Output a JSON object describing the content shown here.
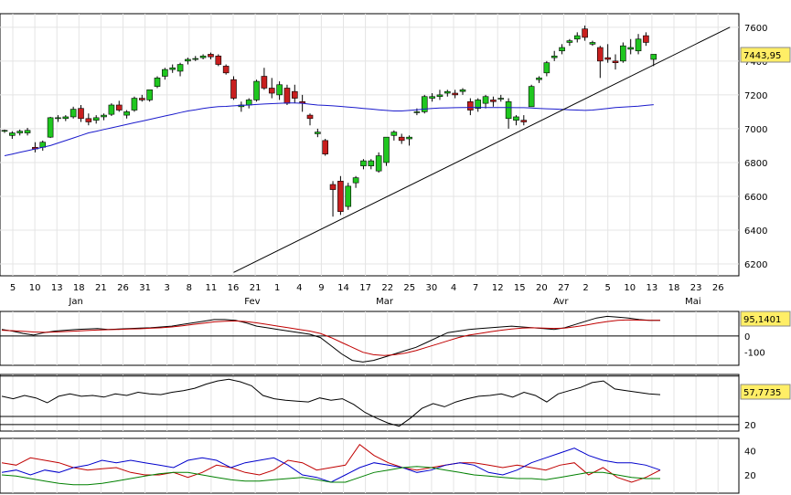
{
  "chart_data": [
    {
      "type": "candlestick",
      "title": "",
      "last_value": "7443,95",
      "ylim": [
        6130,
        7680
      ],
      "y_ticks": [
        {
          "value": 6200,
          "label": "6200"
        },
        {
          "value": 6400,
          "label": "6400"
        },
        {
          "value": 6600,
          "label": "6600"
        },
        {
          "value": 6800,
          "label": "6800"
        },
        {
          "value": 7000,
          "label": "7000"
        },
        {
          "value": 7200,
          "label": "7200"
        },
        {
          "value": 7400,
          "label": "7400"
        },
        {
          "value": 7600,
          "label": "7600"
        }
      ],
      "x_day_labels": [
        "5",
        "10",
        "13",
        "18",
        "21",
        "26",
        "31",
        "3",
        "8",
        "11",
        "16",
        "21",
        "1",
        "4",
        "9",
        "14",
        "17",
        "22",
        "25",
        "30",
        "4",
        "7",
        "12",
        "15",
        "20",
        "27",
        "2",
        "5",
        "10",
        "13",
        "18",
        "23",
        "26"
      ],
      "x_month_labels": [
        {
          "label": "Jan",
          "after_day_index": 1
        },
        {
          "label": "Fev",
          "after_day_index": 9
        },
        {
          "label": "Mar",
          "after_day_index": 15
        },
        {
          "label": "Avr",
          "after_day_index": 23
        },
        {
          "label": "Mai",
          "after_day_index": 29
        }
      ],
      "candles": [
        [
          6985,
          6995,
          6975,
          6990
        ],
        [
          6960,
          6985,
          6940,
          6975
        ],
        [
          6975,
          6995,
          6960,
          6985
        ],
        [
          6975,
          7005,
          6960,
          6990
        ],
        [
          6890,
          6920,
          6860,
          6880
        ],
        [
          6890,
          6930,
          6870,
          6920
        ],
        [
          6950,
          7070,
          6945,
          7065
        ],
        [
          7060,
          7080,
          7040,
          7065
        ],
        [
          7060,
          7080,
          7045,
          7070
        ],
        [
          7070,
          7130,
          7060,
          7115
        ],
        [
          7120,
          7140,
          7040,
          7060
        ],
        [
          7060,
          7090,
          7020,
          7040
        ],
        [
          7050,
          7080,
          7030,
          7065
        ],
        [
          7070,
          7090,
          7050,
          7080
        ],
        [
          7085,
          7150,
          7075,
          7140
        ],
        [
          7140,
          7165,
          7100,
          7110
        ],
        [
          7080,
          7110,
          7060,
          7100
        ],
        [
          7110,
          7190,
          7100,
          7180
        ],
        [
          7180,
          7200,
          7160,
          7170
        ],
        [
          7170,
          7230,
          7160,
          7230
        ],
        [
          7250,
          7310,
          7240,
          7300
        ],
        [
          7310,
          7360,
          7290,
          7350
        ],
        [
          7350,
          7380,
          7330,
          7360
        ],
        [
          7340,
          7390,
          7310,
          7380
        ],
        [
          7400,
          7420,
          7380,
          7410
        ],
        [
          7410,
          7430,
          7400,
          7415
        ],
        [
          7420,
          7440,
          7410,
          7430
        ],
        [
          7440,
          7450,
          7410,
          7425
        ],
        [
          7430,
          7440,
          7370,
          7380
        ],
        [
          7370,
          7380,
          7320,
          7330
        ],
        [
          7290,
          7310,
          7170,
          7180
        ],
        [
          7130,
          7160,
          7100,
          7140
        ],
        [
          7140,
          7180,
          7120,
          7170
        ],
        [
          7170,
          7290,
          7160,
          7280
        ],
        [
          7310,
          7360,
          7230,
          7240
        ],
        [
          7240,
          7300,
          7180,
          7210
        ],
        [
          7200,
          7280,
          7170,
          7260
        ],
        [
          7240,
          7260,
          7140,
          7150
        ],
        [
          7220,
          7260,
          7150,
          7180
        ],
        [
          7160,
          7200,
          7100,
          7150
        ],
        [
          7080,
          7090,
          7020,
          7060
        ],
        [
          6970,
          7000,
          6950,
          6980
        ],
        [
          6930,
          6940,
          6840,
          6850
        ],
        [
          6670,
          6690,
          6480,
          6640
        ],
        [
          6690,
          6720,
          6490,
          6510
        ],
        [
          6540,
          6680,
          6520,
          6660
        ],
        [
          6680,
          6720,
          6650,
          6710
        ],
        [
          6780,
          6820,
          6760,
          6810
        ],
        [
          6780,
          6820,
          6760,
          6810
        ],
        [
          6750,
          6860,
          6740,
          6840
        ],
        [
          6800,
          6950,
          6780,
          6950
        ],
        [
          6960,
          6990,
          6930,
          6980
        ],
        [
          6950,
          6970,
          6910,
          6930
        ],
        [
          6940,
          6960,
          6900,
          6950
        ],
        [
          7100,
          7120,
          7080,
          7100
        ],
        [
          7100,
          7200,
          7090,
          7190
        ],
        [
          7180,
          7210,
          7160,
          7190
        ],
        [
          7190,
          7230,
          7170,
          7200
        ],
        [
          7210,
          7230,
          7190,
          7220
        ],
        [
          7210,
          7230,
          7180,
          7200
        ],
        [
          7220,
          7240,
          7200,
          7230
        ],
        [
          7160,
          7180,
          7080,
          7110
        ],
        [
          7120,
          7180,
          7100,
          7170
        ],
        [
          7150,
          7200,
          7120,
          7190
        ],
        [
          7170,
          7190,
          7130,
          7160
        ],
        [
          7180,
          7200,
          7160,
          7180
        ],
        [
          7060,
          7180,
          7000,
          7160
        ],
        [
          7050,
          7080,
          7020,
          7070
        ],
        [
          7050,
          7080,
          7020,
          7040
        ],
        [
          7130,
          7260,
          7130,
          7250
        ],
        [
          7290,
          7310,
          7270,
          7300
        ],
        [
          7330,
          7400,
          7310,
          7390
        ],
        [
          7420,
          7460,
          7400,
          7430
        ],
        [
          7460,
          7500,
          7440,
          7480
        ],
        [
          7510,
          7530,
          7490,
          7520
        ],
        [
          7530,
          7570,
          7510,
          7550
        ],
        [
          7590,
          7610,
          7520,
          7540
        ],
        [
          7500,
          7520,
          7490,
          7510
        ],
        [
          7480,
          7490,
          7300,
          7400
        ],
        [
          7420,
          7500,
          7390,
          7410
        ],
        [
          7400,
          7440,
          7350,
          7390
        ],
        [
          7400,
          7510,
          7390,
          7490
        ],
        [
          7470,
          7530,
          7440,
          7480
        ],
        [
          7460,
          7560,
          7440,
          7530
        ],
        [
          7550,
          7570,
          7490,
          7510
        ],
        [
          7410,
          7440,
          7370,
          7440
        ]
      ],
      "moving_average": [
        6840,
        6850,
        6860,
        6870,
        6880,
        6890,
        6900,
        6915,
        6930,
        6945,
        6960,
        6975,
        6985,
        6995,
        7005,
        7015,
        7025,
        7035,
        7045,
        7055,
        7065,
        7075,
        7085,
        7095,
        7105,
        7112,
        7120,
        7126,
        7130,
        7132,
        7135,
        7138,
        7140,
        7143,
        7146,
        7148,
        7150,
        7152,
        7152,
        7150,
        7145,
        7140,
        7138,
        7135,
        7132,
        7128,
        7124,
        7120,
        7116,
        7112,
        7108,
        7105,
        7105,
        7108,
        7112,
        7116,
        7120,
        7122,
        7123,
        7124,
        7125,
        7126,
        7126,
        7125,
        7125,
        7125,
        7125,
        7124,
        7124,
        7122,
        7120,
        7118,
        7116,
        7114,
        7112,
        7110,
        7108,
        7110,
        7115,
        7120,
        7125,
        7128,
        7130,
        7133,
        7138,
        7142
      ],
      "trendline": {
        "start": {
          "index": 30,
          "value": 6150
        },
        "end": {
          "index": 95,
          "value": 7600
        }
      }
    },
    {
      "type": "line",
      "last_value": "95,1401",
      "ylim": [
        -180,
        150
      ],
      "y_ticks": [
        {
          "value": 0,
          "label": "0"
        },
        {
          "value": -100,
          "label": "-100"
        }
      ],
      "ref_lines": [
        0
      ],
      "series": [
        {
          "color": "#000000",
          "values": [
            40,
            30,
            15,
            5,
            20,
            30,
            35,
            40,
            42,
            45,
            40,
            42,
            45,
            48,
            50,
            55,
            60,
            70,
            80,
            90,
            100,
            100,
            95,
            80,
            60,
            50,
            40,
            30,
            20,
            10,
            -10,
            -60,
            -110,
            -150,
            -160,
            -150,
            -130,
            -110,
            -90,
            -70,
            -40,
            -10,
            20,
            30,
            40,
            45,
            50,
            55,
            60,
            55,
            50,
            45,
            40,
            50,
            70,
            90,
            110,
            120,
            115,
            110,
            100,
            95,
            95
          ]
        },
        {
          "color": "#c00000",
          "values": [
            35,
            32,
            28,
            24,
            22,
            24,
            27,
            30,
            33,
            36,
            38,
            40,
            42,
            44,
            47,
            50,
            55,
            62,
            70,
            78,
            86,
            90,
            92,
            88,
            80,
            70,
            60,
            50,
            40,
            30,
            15,
            -10,
            -40,
            -70,
            -100,
            -115,
            -120,
            -115,
            -105,
            -90,
            -70,
            -50,
            -30,
            -10,
            5,
            15,
            25,
            35,
            42,
            48,
            50,
            48,
            46,
            48,
            56,
            66,
            78,
            88,
            95,
            98,
            97,
            96,
            95
          ]
        }
      ]
    },
    {
      "type": "line",
      "last_value": "57,7735",
      "ylim": [
        12,
        82
      ],
      "y_ticks": [
        {
          "value": 20,
          "label": "20"
        }
      ],
      "ref_lines": [
        80,
        30,
        20
      ],
      "series": [
        {
          "color": "#000000",
          "values": [
            55,
            52,
            56,
            53,
            47,
            55,
            58,
            55,
            56,
            54,
            58,
            56,
            60,
            58,
            57,
            60,
            62,
            65,
            70,
            74,
            76,
            73,
            68,
            56,
            52,
            50,
            49,
            48,
            53,
            50,
            52,
            45,
            35,
            28,
            22,
            18,
            28,
            40,
            46,
            42,
            48,
            52,
            55,
            56,
            58,
            54,
            60,
            56,
            48,
            58,
            62,
            66,
            72,
            74,
            64,
            62,
            60,
            58,
            57
          ]
        },
        {
          "color": "#000000",
          "values": []
        }
      ]
    },
    {
      "type": "line",
      "ylim": [
        5,
        50
      ],
      "y_ticks": [
        {
          "value": 40,
          "label": "40"
        },
        {
          "value": 20,
          "label": "20"
        }
      ],
      "series": [
        {
          "color": "#c00000",
          "values": [
            30,
            28,
            34,
            32,
            30,
            26,
            24,
            25,
            26,
            22,
            20,
            20,
            22,
            18,
            22,
            28,
            26,
            22,
            20,
            24,
            32,
            30,
            24,
            26,
            28,
            45,
            36,
            30,
            26,
            24,
            26,
            28,
            30,
            30,
            28,
            26,
            28,
            26,
            24,
            28,
            30,
            20,
            26,
            18,
            14,
            18,
            24
          ]
        },
        {
          "color": "#0000cc",
          "values": [
            22,
            24,
            20,
            24,
            22,
            26,
            28,
            32,
            30,
            32,
            30,
            28,
            26,
            32,
            34,
            32,
            26,
            30,
            32,
            34,
            28,
            20,
            18,
            14,
            20,
            26,
            30,
            28,
            26,
            22,
            24,
            28,
            30,
            28,
            22,
            20,
            24,
            30,
            34,
            38,
            42,
            36,
            32,
            30,
            30,
            28,
            24
          ]
        },
        {
          "color": "#008000",
          "values": [
            20,
            19,
            17,
            15,
            13,
            12,
            12,
            13,
            15,
            17,
            19,
            21,
            22,
            22,
            20,
            18,
            16,
            15,
            15,
            16,
            17,
            18,
            16,
            14,
            14,
            18,
            22,
            24,
            26,
            27,
            26,
            24,
            22,
            20,
            19,
            18,
            17,
            17,
            16,
            18,
            20,
            22,
            22,
            20,
            18,
            17,
            17
          ]
        }
      ]
    }
  ]
}
